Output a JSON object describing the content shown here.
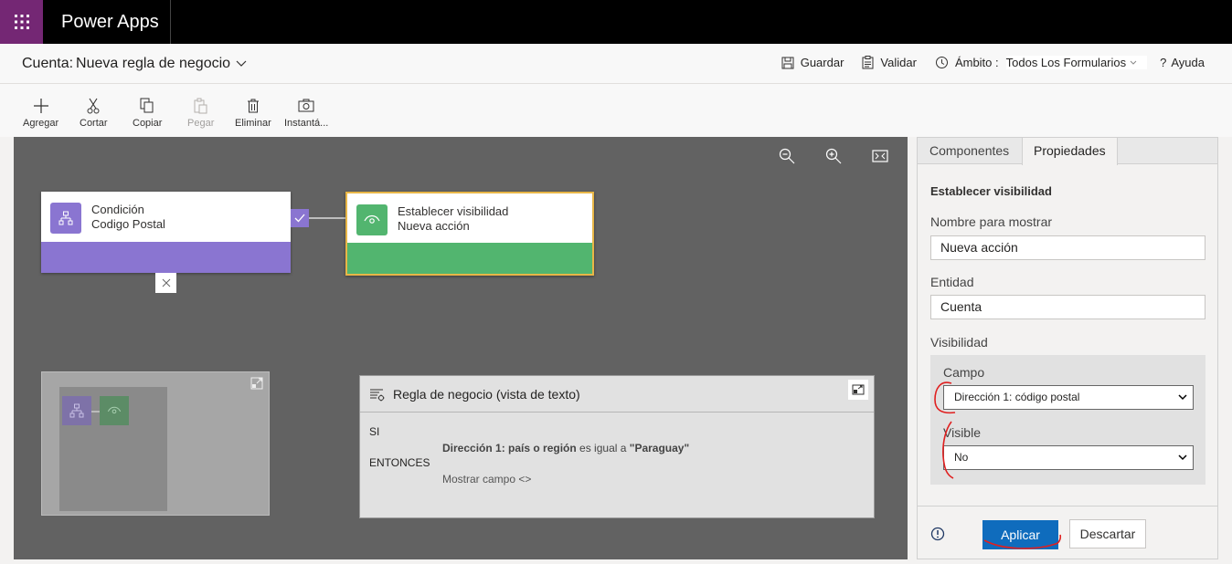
{
  "app": {
    "name": "Power Apps"
  },
  "header": {
    "entity": "Cuenta:",
    "title": "Nueva regla de negocio"
  },
  "actions": {
    "save": "Guardar",
    "validate": "Validar",
    "scope_label": "Ámbito :",
    "scope_value": "Todos Los Formularios",
    "help": "Ayuda"
  },
  "toolbar": {
    "add": "Agregar",
    "cut": "Cortar",
    "copy": "Copiar",
    "paste": "Pegar",
    "delete": "Eliminar",
    "snapshot": "Instantá..."
  },
  "canvas": {
    "condition": {
      "type": "Condición",
      "name": "Codigo Postal",
      "color": "#8a75d1"
    },
    "action": {
      "type": "Establecer visibilidad",
      "name": "Nueva acción",
      "color": "#52b56f"
    },
    "textview": {
      "title": "Regla de negocio (vista de texto)",
      "si": "SI",
      "field": "Dirección 1: país o región",
      "op": "es igual a",
      "value": "\"Paraguay\"",
      "then": "ENTONCES",
      "action": "Mostrar campo <>"
    }
  },
  "panel": {
    "tabs": [
      "Componentes",
      "Propiedades"
    ],
    "section_title": "Establecer visibilidad",
    "display_name_label": "Nombre para mostrar",
    "display_name_value": "Nueva acción",
    "entity_label": "Entidad",
    "entity_value": "Cuenta",
    "visibility_label": "Visibilidad",
    "field_label": "Campo",
    "field_value": "Dirección 1: código postal",
    "visible_label": "Visible",
    "visible_value": "No",
    "apply": "Aplicar",
    "discard": "Descartar"
  },
  "colors": {
    "accent": "#0f6cbd",
    "brand": "#742774",
    "selected_border": "#e8b647"
  }
}
